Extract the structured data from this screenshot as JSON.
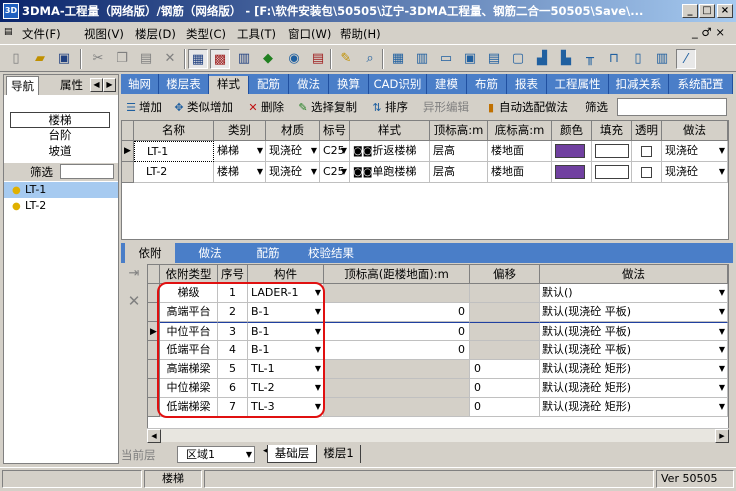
{
  "window": {
    "title": "3DMA-工程量（网络版）/钢筋（网络版） - [F:\\软件安装包\\50505\\辽宁-3DMA工程量、钢筋二合一50505\\Save\\...",
    "app_icon_text": "3D",
    "min_glyph": "_",
    "max_glyph": "□",
    "close_glyph": "×"
  },
  "menu": {
    "items": [
      "文件(F)",
      "视图(V)",
      "楼层(D)",
      "类型(C)",
      "工具(T)",
      "窗口(W)",
      "帮助(H)"
    ],
    "mdi_controls": "_ ♂ ×"
  },
  "left_panel": {
    "tab_nav": "导航",
    "tab_props": "属性",
    "categories": [
      "楼梯",
      "台阶",
      "坡道"
    ],
    "filter_label": "筛选",
    "tree_items": [
      "LT-1",
      "LT-2"
    ]
  },
  "top_tabs": [
    "轴网",
    "楼层表",
    "样式",
    "配筋",
    "做法",
    "换算",
    "CAD识别",
    "建模",
    "布筋",
    "报表",
    "工程属性",
    "扣减关系",
    "系统配置"
  ],
  "action_bar": {
    "add": "增加",
    "similar_add": "类似增加",
    "delete": "删除",
    "select_copy": "选择复制",
    "sort": "排序",
    "special_edit": "异形编辑",
    "auto_match": "自动选配做法",
    "filter": "筛选"
  },
  "style_grid": {
    "headers": [
      "名称",
      "类别",
      "材质",
      "标号",
      "样式",
      "顶标高:m",
      "底标高:m",
      "颜色",
      "填充",
      "透明",
      "做法"
    ],
    "rows": [
      {
        "name": "LT-1",
        "category": "梯梯",
        "material": "现浇砼",
        "grade": "C25",
        "style": "折返楼梯",
        "top": "层高",
        "bottom": "楼地面",
        "method": "现浇砼"
      },
      {
        "name": "LT-2",
        "category": "楼梯",
        "material": "现浇砼",
        "grade": "C25",
        "style": "单跑楼梯",
        "top": "层高",
        "bottom": "楼地面",
        "method": "现浇砼"
      }
    ],
    "colors": {
      "swatch": "#7040a0"
    }
  },
  "sub_tabs": [
    "依附",
    "做法",
    "配筋",
    "校验结果"
  ],
  "attach_grid": {
    "headers": [
      "依附类型",
      "序号",
      "构件",
      "顶标高(距楼地面):m",
      "偏移",
      "做法"
    ],
    "rows": [
      {
        "type": "梯级",
        "seq": "1",
        "comp": "LADER-1",
        "elev": "",
        "offset": "",
        "method": "默认()"
      },
      {
        "type": "高端平台",
        "seq": "2",
        "comp": "B-1",
        "elev": "0",
        "offset": "",
        "method": "默认(现浇砼 平板)"
      },
      {
        "type": "中位平台",
        "seq": "3",
        "comp": "B-1",
        "elev": "0",
        "offset": "",
        "method": "默认(现浇砼 平板)"
      },
      {
        "type": "低端平台",
        "seq": "4",
        "comp": "B-1",
        "elev": "0",
        "offset": "",
        "method": "默认(现浇砼 平板)"
      },
      {
        "type": "高端梯梁",
        "seq": "5",
        "comp": "TL-1",
        "elev": "",
        "offset": "0",
        "method": "默认(现浇砼 矩形)"
      },
      {
        "type": "中位梯梁",
        "seq": "6",
        "comp": "TL-2",
        "elev": "",
        "offset": "0",
        "method": "默认(现浇砼 矩形)"
      },
      {
        "type": "低端梯梁",
        "seq": "7",
        "comp": "TL-3",
        "elev": "",
        "offset": "0",
        "method": "默认(现浇砼 矩形)"
      }
    ]
  },
  "floor_bar": {
    "current_label": "当前层",
    "zone": "区域1",
    "tabs": [
      "基础层",
      "楼层1"
    ]
  },
  "status": {
    "type": "楼梯",
    "version": "Ver 50505"
  }
}
